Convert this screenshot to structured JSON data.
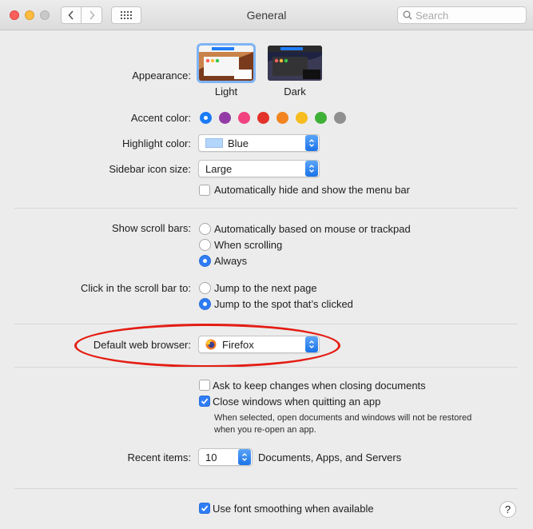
{
  "window": {
    "title": "General"
  },
  "search": {
    "placeholder": "Search"
  },
  "appearance": {
    "label": "Appearance:",
    "options": [
      {
        "label": "Light",
        "selected": true
      },
      {
        "label": "Dark",
        "selected": false
      }
    ]
  },
  "accent": {
    "label": "Accent color:",
    "colors": [
      "#1a7bf6",
      "#943ca6",
      "#f1417f",
      "#e2322a",
      "#f28520",
      "#f7bc1d",
      "#3fb037",
      "#909090"
    ],
    "selected_index": 0
  },
  "highlight": {
    "label": "Highlight color:",
    "value": "Blue",
    "swatch": "#b3d6fd"
  },
  "sidebar_icon": {
    "label": "Sidebar icon size:",
    "value": "Large"
  },
  "menubar": {
    "label": "Automatically hide and show the menu bar",
    "checked": false
  },
  "scrollbars": {
    "label": "Show scroll bars:",
    "options": [
      "Automatically based on mouse or trackpad",
      "When scrolling",
      "Always"
    ],
    "selected": "Always"
  },
  "scrollclick": {
    "label": "Click in the scroll bar to:",
    "options": [
      "Jump to the next page",
      "Jump to the spot that’s clicked"
    ],
    "selected": "Jump to the spot that’s clicked"
  },
  "browser": {
    "label": "Default web browser:",
    "value": "Firefox",
    "icon": "firefox-icon"
  },
  "ask_keep": {
    "label": "Ask to keep changes when closing documents",
    "checked": false
  },
  "close_windows": {
    "label": "Close windows when quitting an app",
    "checked": true
  },
  "note": {
    "line1": "When selected, open documents and windows will not be restored",
    "line2": "when you re-open an app."
  },
  "recent": {
    "label": "Recent items:",
    "value": "10",
    "suffix": "Documents, Apps, and Servers"
  },
  "font_smoothing": {
    "label": "Use font smoothing when available",
    "checked": true
  },
  "help": {
    "label": "?"
  }
}
